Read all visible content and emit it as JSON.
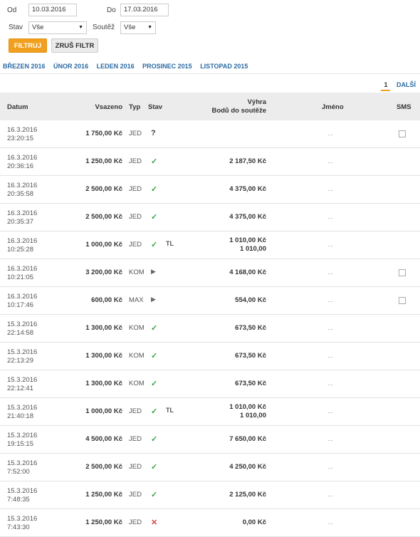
{
  "filters": {
    "od_label": "Od",
    "od_value": "10.03.2016",
    "do_label": "Do",
    "do_value": "17.03.2016",
    "stav_label": "Stav",
    "stav_value": "Vše",
    "soutez_label": "Soutěž",
    "soutez_value": "Vše",
    "filter_button": "FILTRUJ",
    "clear_button": "ZRUŠ FILTR"
  },
  "months": [
    "BŘEZEN 2016",
    "ÚNOR 2016",
    "LEDEN 2016",
    "PROSINEC 2015",
    "LISTOPAD 2015"
  ],
  "pager": {
    "current": "1",
    "next": "DALŠÍ"
  },
  "columns": {
    "datum": "Datum",
    "vsazeno": "Vsazeno",
    "typ": "Typ",
    "stav": "Stav",
    "vyhra": "Výhra",
    "body": "Bodů do soutěže",
    "jmeno": "Jméno",
    "sms": "SMS"
  },
  "colors": {
    "accent": "#f0a01e",
    "link": "#2b6aa3",
    "ok": "#3aa34a",
    "lost": "#d64545"
  },
  "bets": [
    {
      "date": "16.3.2016",
      "time": "23:20:15",
      "amount": "1 750,00 Kč",
      "type": "JED",
      "status": "?",
      "status_icon": "question-icon",
      "tl": false,
      "win": "",
      "points": "",
      "name": "...",
      "sms": true
    },
    {
      "date": "16.3.2016",
      "time": "20:36:16",
      "amount": "1 250,00 Kč",
      "type": "JED",
      "status": "✓",
      "status_icon": "check-icon",
      "tl": false,
      "win": "2 187,50 Kč",
      "points": "",
      "name": "...",
      "sms": false
    },
    {
      "date": "16.3.2016",
      "time": "20:35:58",
      "amount": "2 500,00 Kč",
      "type": "JED",
      "status": "✓",
      "status_icon": "check-icon",
      "tl": false,
      "win": "4 375,00 Kč",
      "points": "",
      "name": "...",
      "sms": false
    },
    {
      "date": "16.3.2016",
      "time": "20:35:37",
      "amount": "2 500,00 Kč",
      "type": "JED",
      "status": "✓",
      "status_icon": "check-icon",
      "tl": false,
      "win": "4 375,00 Kč",
      "points": "",
      "name": "...",
      "sms": false
    },
    {
      "date": "16.3.2016",
      "time": "10:25:28",
      "amount": "1 000,00 Kč",
      "type": "JED",
      "status": "✓",
      "status_icon": "check-icon",
      "tl": true,
      "win": "1 010,00 Kč",
      "points": "1 010,00",
      "name": "...",
      "sms": false
    },
    {
      "date": "16.3.2016",
      "time": "10:21:05",
      "amount": "3 200,00 Kč",
      "type": "KOM",
      "status": "▶",
      "status_icon": "play-icon",
      "tl": false,
      "win": "4 168,00 Kč",
      "points": "",
      "name": "...",
      "sms": true
    },
    {
      "date": "16.3.2016",
      "time": "10:17:46",
      "amount": "600,00 Kč",
      "type": "MAX",
      "status": "▶",
      "status_icon": "play-icon",
      "tl": false,
      "win": "554,00 Kč",
      "points": "",
      "name": "...",
      "sms": true
    },
    {
      "date": "15.3.2016",
      "time": "22:14:58",
      "amount": "1 300,00 Kč",
      "type": "KOM",
      "status": "✓",
      "status_icon": "check-icon",
      "tl": false,
      "win": "673,50 Kč",
      "points": "",
      "name": "...",
      "sms": false
    },
    {
      "date": "15.3.2016",
      "time": "22:13:29",
      "amount": "1 300,00 Kč",
      "type": "KOM",
      "status": "✓",
      "status_icon": "check-icon",
      "tl": false,
      "win": "673,50 Kč",
      "points": "",
      "name": "...",
      "sms": false
    },
    {
      "date": "15.3.2016",
      "time": "22:12:41",
      "amount": "1 300,00 Kč",
      "type": "KOM",
      "status": "✓",
      "status_icon": "check-icon",
      "tl": false,
      "win": "673,50 Kč",
      "points": "",
      "name": "...",
      "sms": false
    },
    {
      "date": "15.3.2016",
      "time": "21:40:18",
      "amount": "1 000,00 Kč",
      "type": "JED",
      "status": "✓",
      "status_icon": "check-icon",
      "tl": true,
      "win": "1 010,00 Kč",
      "points": "1 010,00",
      "name": "...",
      "sms": false
    },
    {
      "date": "15.3.2016",
      "time": "19:15:15",
      "amount": "4 500,00 Kč",
      "type": "JED",
      "status": "✓",
      "status_icon": "check-icon",
      "tl": false,
      "win": "7 650,00 Kč",
      "points": "",
      "name": "...",
      "sms": false
    },
    {
      "date": "15.3.2016",
      "time": "7:52:00",
      "amount": "2 500,00 Kč",
      "type": "JED",
      "status": "✓",
      "status_icon": "check-icon",
      "tl": false,
      "win": "4 250,00 Kč",
      "points": "",
      "name": "...",
      "sms": false
    },
    {
      "date": "15.3.2016",
      "time": "7:48:35",
      "amount": "1 250,00 Kč",
      "type": "JED",
      "status": "✓",
      "status_icon": "check-icon",
      "tl": false,
      "win": "2 125,00 Kč",
      "points": "",
      "name": "...",
      "sms": false
    },
    {
      "date": "15.3.2016",
      "time": "7:43:30",
      "amount": "1 250,00 Kč",
      "type": "JED",
      "status": "✕",
      "status_icon": "cross-icon",
      "tl": false,
      "win": "0,00 Kč",
      "points": "",
      "name": "...",
      "sms": false
    }
  ],
  "tl_label": "TL"
}
